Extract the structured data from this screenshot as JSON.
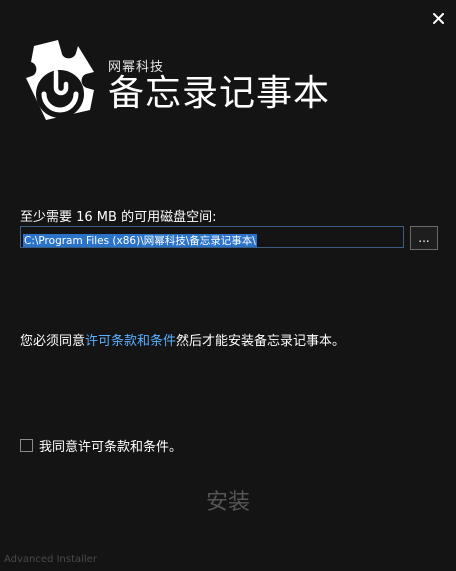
{
  "header": {
    "company": "网幂科技",
    "app_title": "备忘录记事本"
  },
  "icons": {
    "close": "close-icon",
    "logo": "app-logo-icon"
  },
  "disk": {
    "label": "至少需要 16 MB 的可用磁盘空间:",
    "install_path": "C:\\Program Files (x86)\\网幂科技\\备忘录记事本\\",
    "browse_label": "..."
  },
  "license": {
    "prefix": "您必须同意",
    "link_text": "许可条款和条件",
    "suffix": "然后才能安装备忘录记事本。",
    "checkbox_label": "我同意许可条款和条件。",
    "checked": false
  },
  "actions": {
    "install_label": "安装"
  },
  "footer": {
    "brand": "Advanced Installer"
  },
  "colors": {
    "background": "#141414",
    "link": "#5ab0ff",
    "selection": "#2a73c9",
    "disabled_text": "#555555"
  }
}
